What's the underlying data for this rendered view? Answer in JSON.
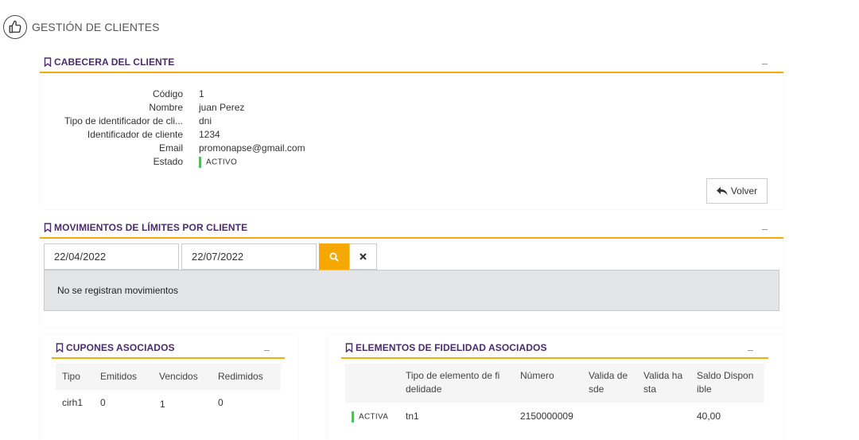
{
  "page": {
    "title": "GESTIÓN DE CLIENTES"
  },
  "cabecera": {
    "title": "CABECERA DEL CLIENTE",
    "fields": [
      {
        "label": "Código",
        "value": "1"
      },
      {
        "label": "Nombre",
        "value": "juan Perez"
      },
      {
        "label": "Tipo de identificador de cli...",
        "value": "dni"
      },
      {
        "label": "Identificador de cliente",
        "value": "1234"
      },
      {
        "label": "Email",
        "value": "promonapse@gmail.com"
      }
    ],
    "estado_label": "Estado",
    "estado_value": "ACTIVO",
    "volver_label": "Volver"
  },
  "movimientos": {
    "title": "MOVIMIENTOS DE LÍMITES POR CLIENTE",
    "date_from": "22/04/2022",
    "date_to": "22/07/2022",
    "empty_message": "No se registran movimientos"
  },
  "cupones": {
    "title": "CUPONES ASOCIADOS",
    "headers": [
      "Tipo",
      "Emitidos",
      "Vencidos",
      "Redimidos"
    ],
    "rows": [
      [
        "cirh1",
        "0",
        "1",
        "0"
      ]
    ]
  },
  "fidelidad": {
    "title": "ELEMENTOS DE FIDELIDAD ASOCIADOS",
    "headers": [
      "Tipo de elemento de fi delidade",
      "Número",
      "Valida de sde",
      "Valida ha sta",
      "Saldo Dispon ible"
    ],
    "rows": [
      {
        "estado": "ACTIVA",
        "tipo": "tn1",
        "numero": "2150000009",
        "desde": "",
        "hasta": "",
        "saldo": "40,00"
      }
    ]
  },
  "colors": {
    "accent": "#f2ac0a",
    "title": "#4a2b6e",
    "active": "#5cb85c"
  }
}
